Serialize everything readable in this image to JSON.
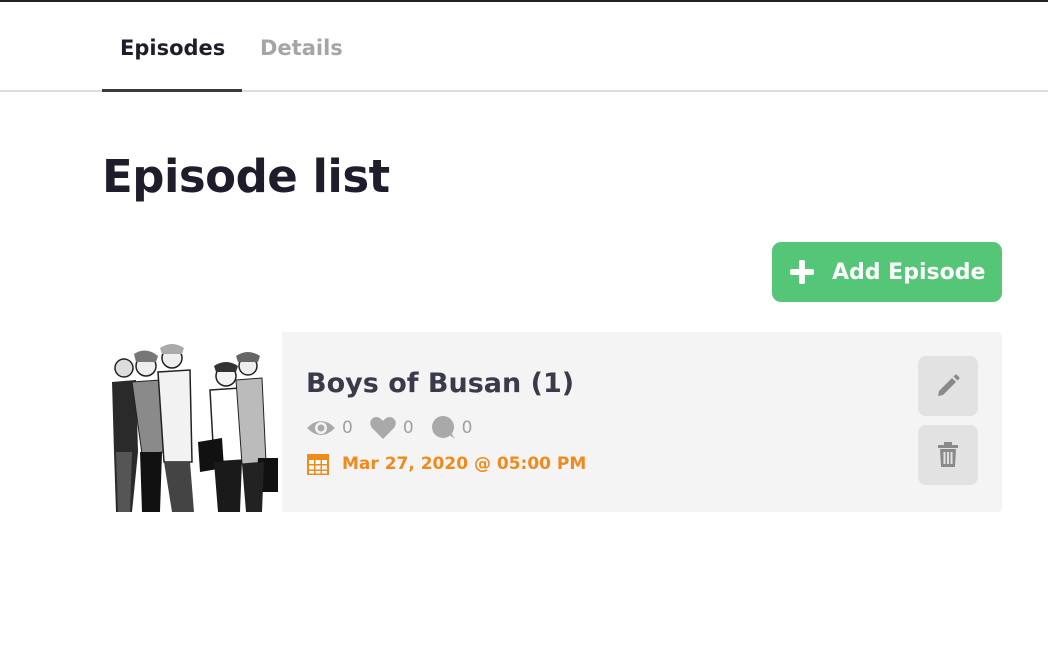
{
  "tabs": [
    {
      "label": "Episodes",
      "active": true
    },
    {
      "label": "Details",
      "active": false
    }
  ],
  "page_title": "Episode list",
  "add_button": {
    "label": "Add Episode"
  },
  "colors": {
    "accent_green": "#55c677",
    "date_orange": "#f08a1c",
    "icon_gray": "#a0a0a0"
  },
  "episodes": [
    {
      "title": "Boys of Busan (1)",
      "views": "0",
      "likes": "0",
      "comments": "0",
      "date": "Mar 27, 2020 @ 05:00 PM",
      "icons": [
        "eye-icon",
        "heart-icon",
        "comment-icon",
        "calendar-icon",
        "pencil-icon",
        "trash-icon"
      ]
    }
  ]
}
